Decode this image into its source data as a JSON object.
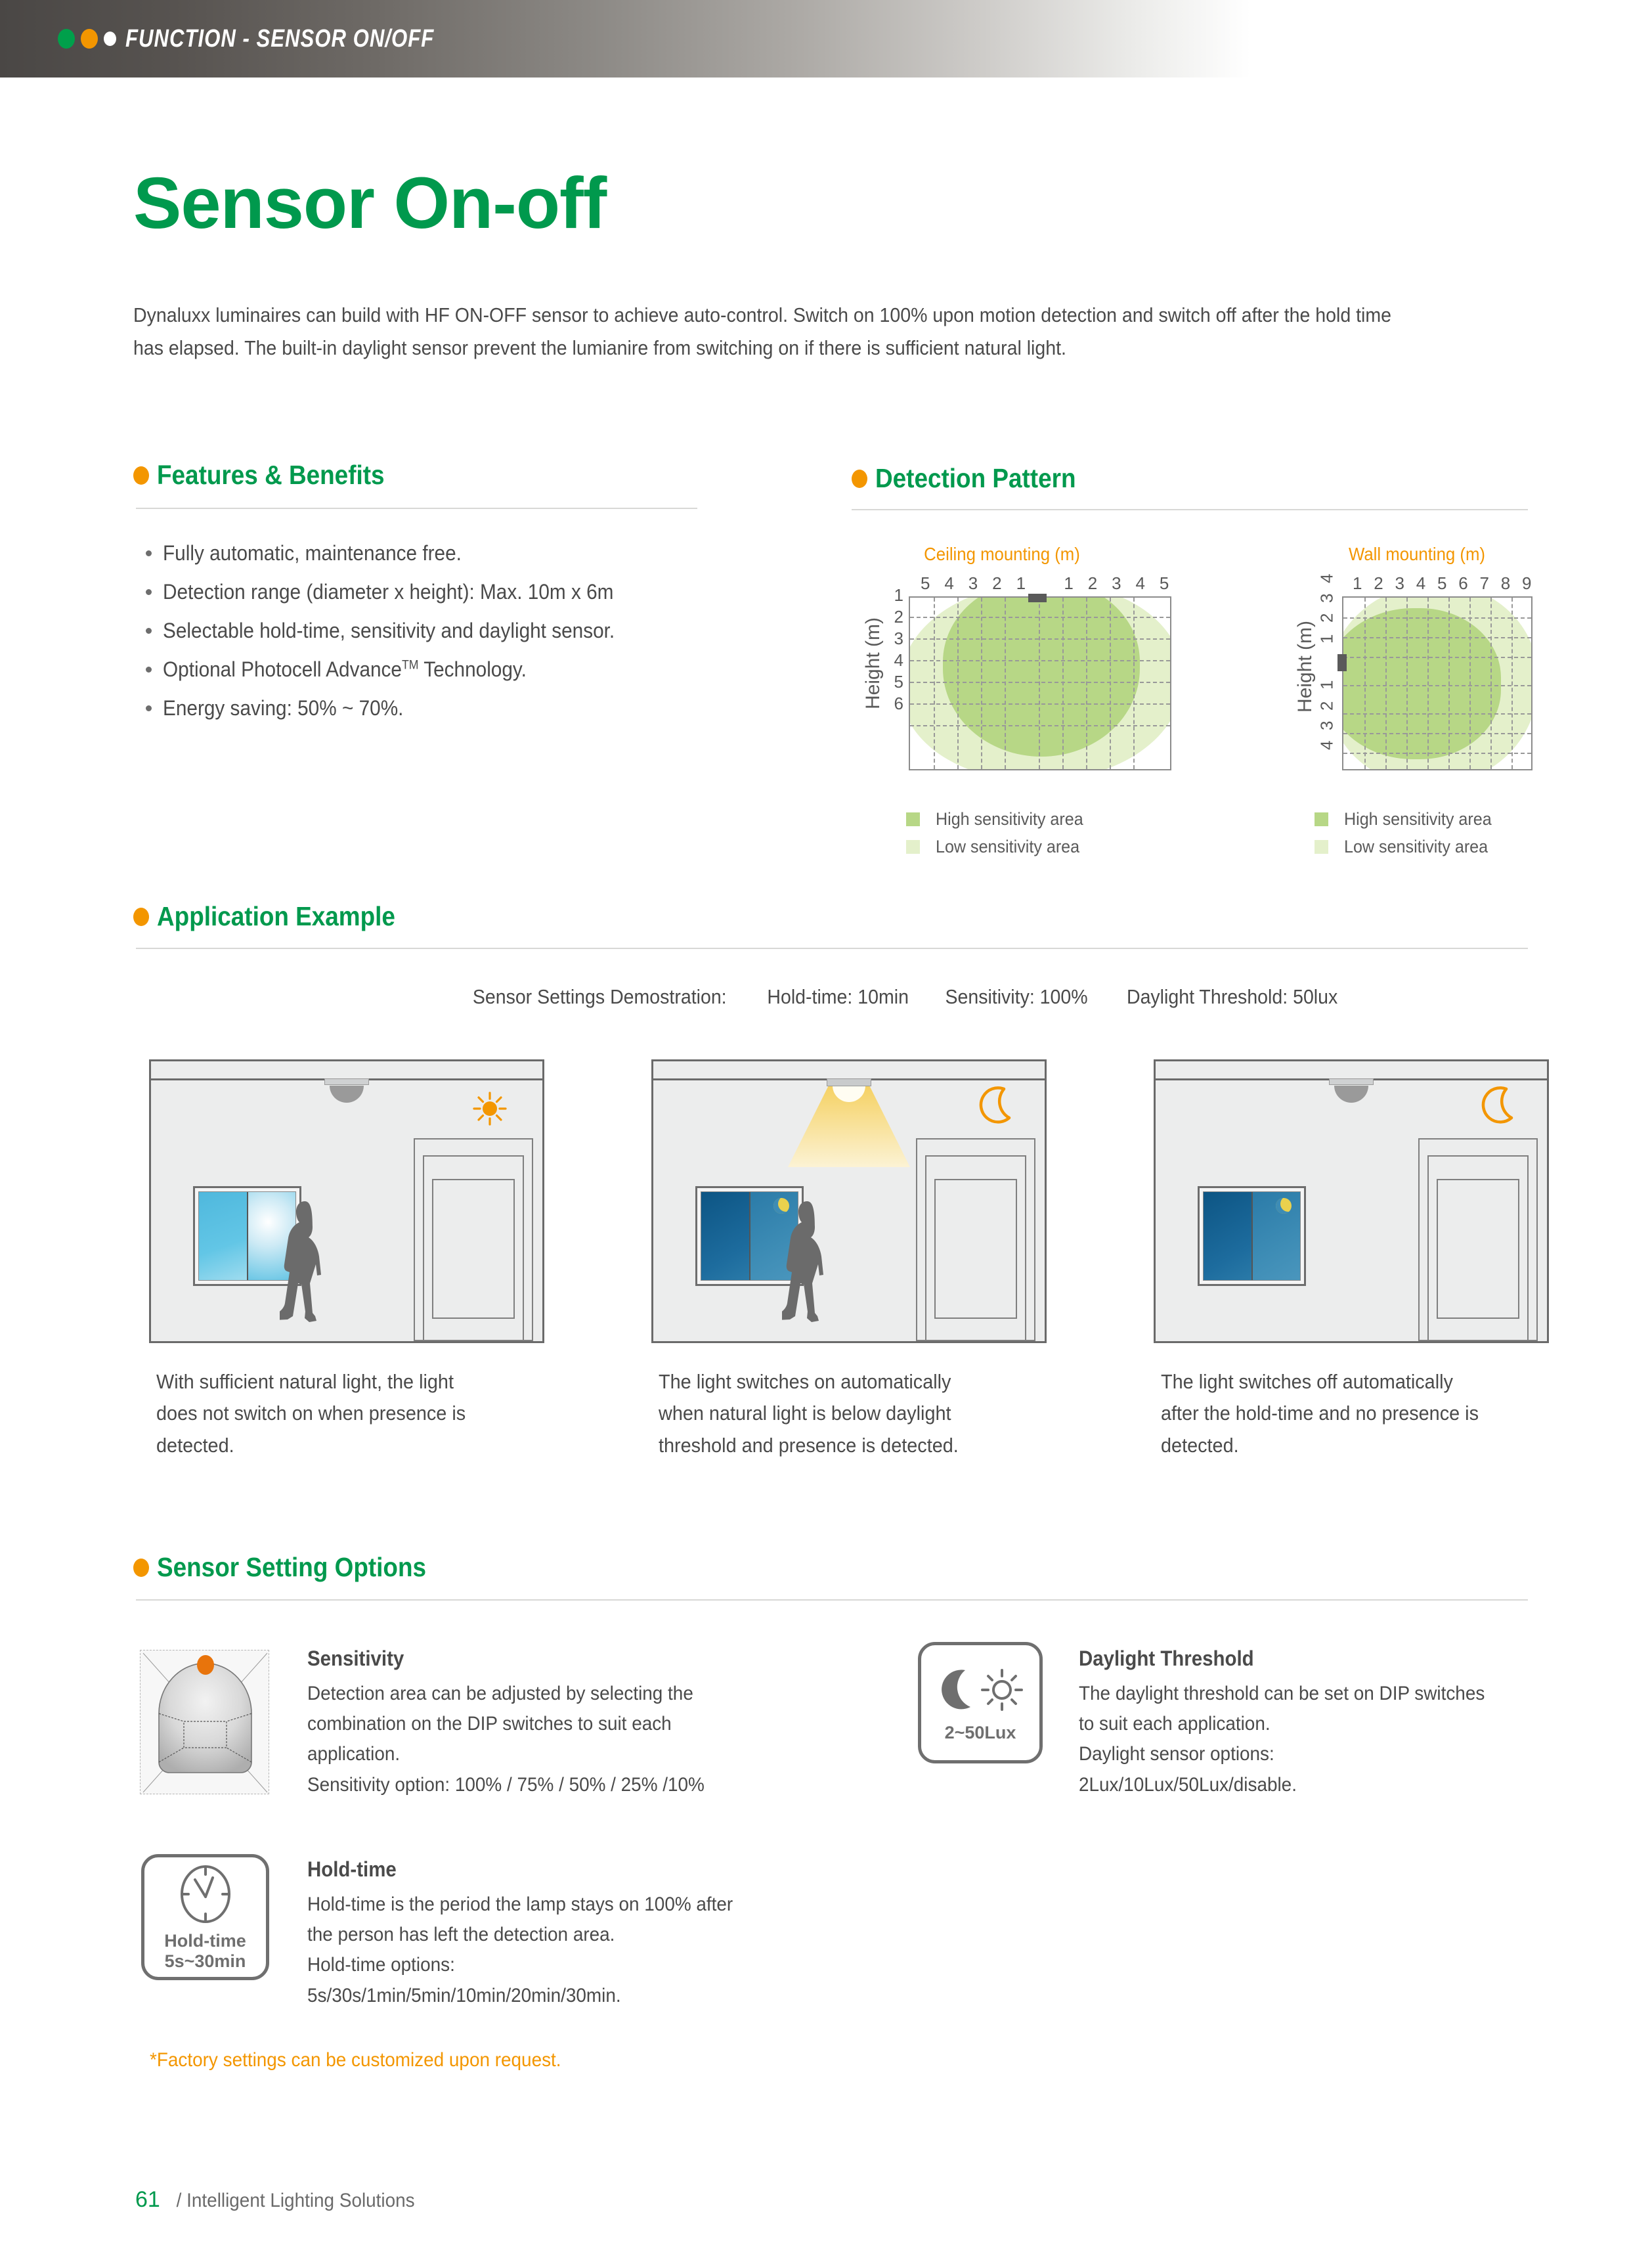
{
  "header": {
    "breadcrumb": "FUNCTION - SENSOR ON/OFF",
    "dot_colors": [
      "#00a04b",
      "#f39600",
      "#ffffff"
    ]
  },
  "page_title": "Sensor On-off",
  "intro": "Dynaluxx luminaires can build with HF ON-OFF sensor to achieve auto-control. Switch on 100% upon motion detection and switch off after the hold time has elapsed. The built-in daylight sensor prevent the lumianire from switching on if there is sufficient natural light.",
  "colors": {
    "green": "#00994d",
    "orange": "#f39600",
    "high_sensitivity": "#b7d786",
    "low_sensitivity": "#e4f0cb",
    "body_text": "#4a4a4a"
  },
  "sections": {
    "features": {
      "title": "Features & Benefits",
      "items": [
        "Fully automatic, maintenance free.",
        "Detection range (diameter x height): Max. 10m x 6m",
        "Selectable hold-time, sensitivity and daylight sensor.",
        "Optional Photocell Advance™ Technology.",
        "Energy saving: 50% ~ 70%."
      ],
      "item4_main": "Optional Photocell Advance",
      "item4_sup": "TM",
      "item4_tail": " Technology."
    },
    "detection": {
      "title": "Detection Pattern"
    },
    "application": {
      "title": "Application Example"
    },
    "options": {
      "title": "Sensor Setting Options"
    }
  },
  "chart_data": [
    {
      "type": "area",
      "title": "Ceiling mounting (m)",
      "xlabel": "",
      "ylabel": "Height (m)",
      "x_ticks": [
        "5",
        "4",
        "3",
        "2",
        "1",
        "",
        "1",
        "2",
        "3",
        "4",
        "5"
      ],
      "y_ticks": [
        "1",
        "2",
        "3",
        "4",
        "5",
        "6"
      ],
      "xlim": [
        -5,
        5
      ],
      "ylim": [
        0,
        7
      ],
      "grid": true,
      "sensor_position": "top-center",
      "series": [
        {
          "name": "High sensitivity area",
          "color": "#b7d786",
          "extent_x": [
            -3.6,
            3.6
          ],
          "extent_y": [
            0,
            6.2
          ]
        },
        {
          "name": "Low sensitivity area",
          "color": "#e4f0cb",
          "extent_x": [
            -5.0,
            5.0
          ],
          "extent_y": [
            0,
            7.0
          ]
        }
      ],
      "legend": [
        "High sensitivity area",
        "Low sensitivity area"
      ],
      "legend_position": "below"
    },
    {
      "type": "area",
      "title": "Wall mounting (m)",
      "xlabel": "",
      "ylabel": "Height (m)",
      "x_ticks": [
        "1",
        "2",
        "3",
        "4",
        "5",
        "6",
        "7",
        "8",
        "9"
      ],
      "y_ticks": [
        "4",
        "3",
        "2",
        "1",
        "",
        "1",
        "2",
        "3",
        "4"
      ],
      "xlim": [
        0,
        9
      ],
      "ylim": [
        -4,
        4
      ],
      "grid": true,
      "sensor_position": "left-center",
      "series": [
        {
          "name": "High sensitivity area",
          "color": "#b7d786",
          "extent_x": [
            0,
            7.4
          ],
          "extent_y": [
            -3.0,
            3.0
          ]
        },
        {
          "name": "Low sensitivity area",
          "color": "#e4f0cb",
          "extent_x": [
            0,
            9.0
          ],
          "extent_y": [
            -4.0,
            4.0
          ]
        }
      ],
      "legend": [
        "High sensitivity area",
        "Low sensitivity area"
      ],
      "legend_position": "below"
    }
  ],
  "demo": {
    "label": "Sensor Settings Demostration:",
    "hold_time": "Hold-time: 10min",
    "sensitivity": "Sensitivity: 100%",
    "daylight": "Daylight Threshold: 50lux"
  },
  "scenes": [
    {
      "state": "day-light-off",
      "sky_icon": "sun-icon",
      "caption_l1": "With sufficient natural light, the light",
      "caption_l2": "does not switch on when presence is",
      "caption_l3": "detected."
    },
    {
      "state": "night-light-on",
      "sky_icon": "moon-icon",
      "caption_l1": "The light switches on automatically",
      "caption_l2": "when natural light is below daylight",
      "caption_l3": "threshold and presence is detected."
    },
    {
      "state": "night-light-off",
      "sky_icon": "moon-icon",
      "caption_l1": "The light switches off automatically",
      "caption_l2": "after the hold-time and no presence is",
      "caption_l3": "detected."
    }
  ],
  "options": {
    "sensitivity": {
      "title": "Sensitivity",
      "l1": "Detection area can be adjusted by selecting the",
      "l2": "combination on the DIP switches to suit each",
      "l3": "application.",
      "l4": "Sensitivity option: 100% / 75% / 50% / 25% /10%"
    },
    "daylight": {
      "icon_caption": "2~50Lux",
      "title": "Daylight Threshold",
      "l1": "The daylight threshold can be set on DIP switches",
      "l2": "to suit each  application.",
      "l3": "Daylight sensor options:",
      "l4": "2Lux/10Lux/50Lux/disable."
    },
    "holdtime": {
      "icon_caption_l1": "Hold-time",
      "icon_caption_l2": "5s~30min",
      "title": "Hold-time",
      "l1": "Hold-time is the period the lamp stays on 100% after",
      "l2": "the person has left the detection area.",
      "l3": "Hold-time  options:",
      "l4": "5s/30s/1min/5min/10min/20min/30min."
    }
  },
  "footnote": "*Factory settings  can be customized upon request.",
  "footer": {
    "page": "61",
    "text": "/ Intelligent Lighting Solutions"
  }
}
